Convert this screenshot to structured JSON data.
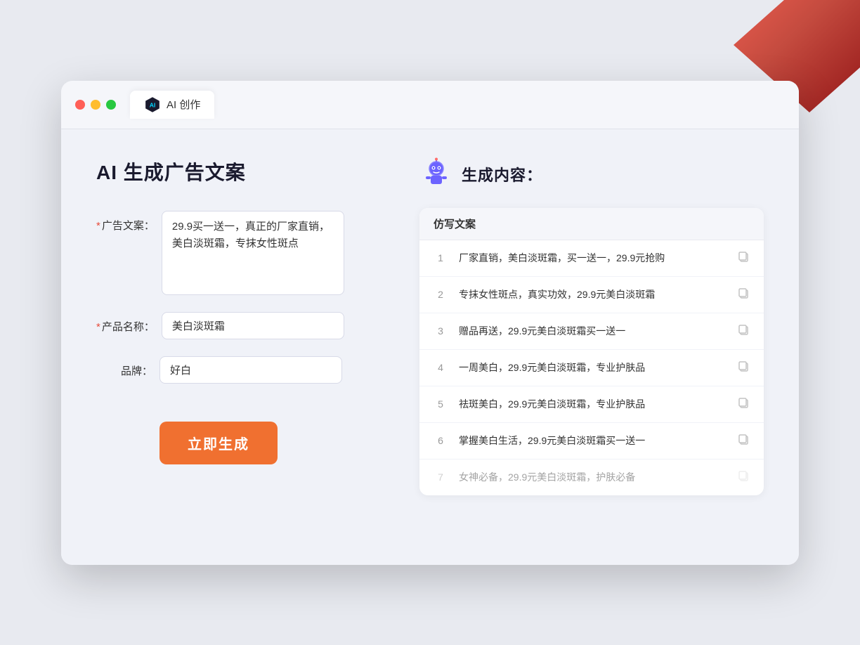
{
  "window": {
    "tab_label": "AI 创作"
  },
  "page": {
    "title": "AI 生成广告文案",
    "result_title": "生成内容："
  },
  "form": {
    "ad_copy_label": "广告文案：",
    "ad_copy_required": true,
    "ad_copy_value": "29.9买一送一，真正的厂家直销，美白淡斑霜，专抹女性斑点",
    "product_name_label": "产品名称：",
    "product_name_required": true,
    "product_name_value": "美白淡斑霜",
    "brand_label": "品牌：",
    "brand_required": false,
    "brand_value": "好白",
    "generate_button": "立即生成"
  },
  "results": {
    "table_header": "仿写文案",
    "items": [
      {
        "id": 1,
        "text": "厂家直销，美白淡斑霜，买一送一，29.9元抢购",
        "muted": false
      },
      {
        "id": 2,
        "text": "专抹女性斑点，真实功效，29.9元美白淡斑霜",
        "muted": false
      },
      {
        "id": 3,
        "text": "赠品再送，29.9元美白淡斑霜买一送一",
        "muted": false
      },
      {
        "id": 4,
        "text": "一周美白，29.9元美白淡斑霜，专业护肤品",
        "muted": false
      },
      {
        "id": 5,
        "text": "祛斑美白，29.9元美白淡斑霜，专业护肤品",
        "muted": false
      },
      {
        "id": 6,
        "text": "掌握美白生活，29.9元美白淡斑霜买一送一",
        "muted": false
      },
      {
        "id": 7,
        "text": "女神必备，29.9元美白淡斑霜，护肤必备",
        "muted": true
      }
    ]
  },
  "colors": {
    "accent_orange": "#f07030",
    "accent_purple": "#6c63ff",
    "required_red": "#e74c3c"
  }
}
